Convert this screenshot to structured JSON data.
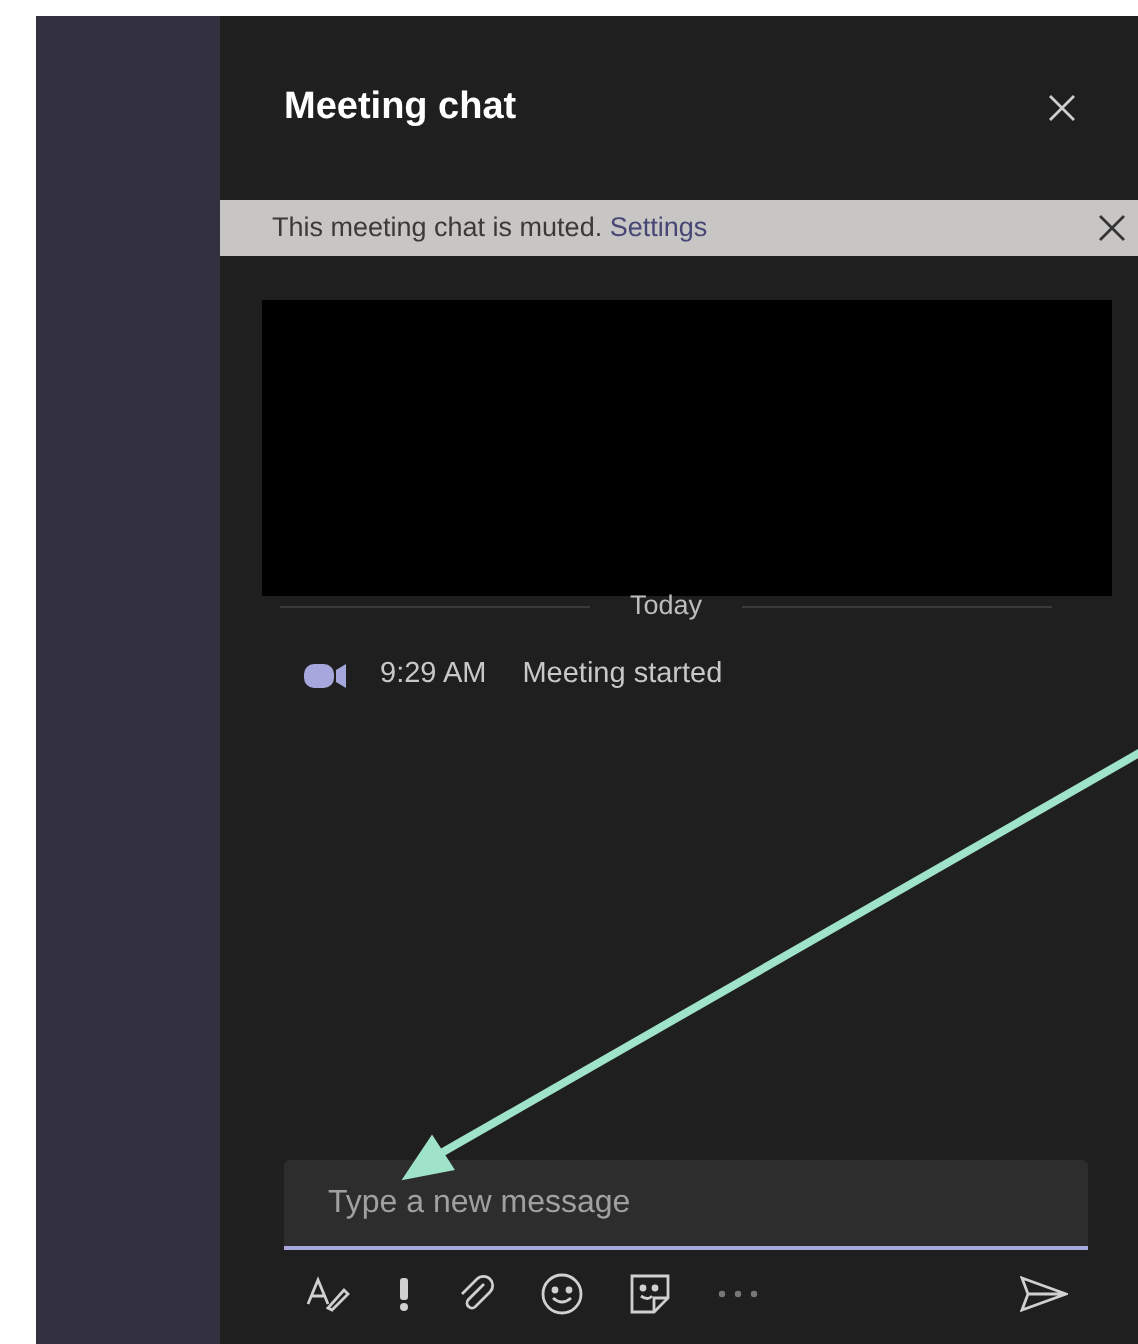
{
  "panel": {
    "title": "Meeting chat"
  },
  "banner": {
    "text": "This meeting chat is muted.",
    "link": "Settings"
  },
  "divider_label": "Today",
  "events": [
    {
      "time": "9:29 AM",
      "text": "Meeting started"
    }
  ],
  "composer": {
    "placeholder": "Type a new message"
  },
  "toolbar": [
    {
      "kind": "format"
    },
    {
      "kind": "important"
    },
    {
      "kind": "attach"
    },
    {
      "kind": "emoji"
    },
    {
      "kind": "sticker"
    },
    {
      "kind": "more"
    }
  ]
}
